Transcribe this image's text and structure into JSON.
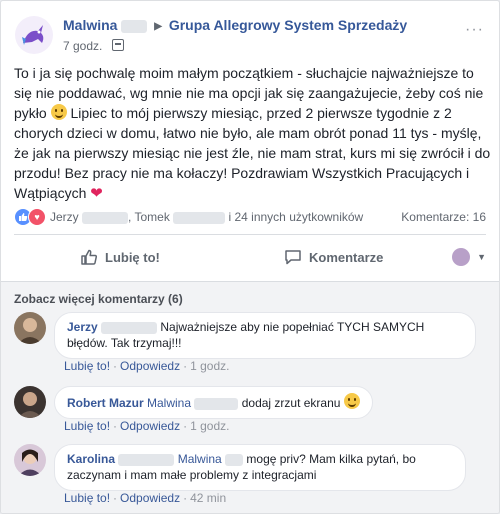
{
  "post": {
    "author": "Malwina",
    "group": "Grupa Allegrowy System Sprzedaży",
    "time": "7 godz.",
    "text_1": "To i ja się pochwalę moim małym początkiem - słuchajcie najważniejsze to się nie poddawać, wg mnie nie ma opcji jak się zaangażujecie, żeby coś nie pykło ",
    "text_2": " Lipiec to mój pierwszy miesiąc, przed 2 pierwsze tygodnie z 2 chorych dzieci w domu, łatwo nie było, ale mam obrót ponad 11 tys - myślę, że jak na pierwszy miesiąc nie jest źle, nie mam strat, kurs mi się zwrócił i do przodu! Bez pracy nie ma kołaczy! Pozdrawiam Wszystkich Pracujących i Wątpiących ",
    "heart": "❤"
  },
  "reactions": {
    "name1": "Jerzy",
    "sep": ", ",
    "name2": "Tomek",
    "others": " i 24 innych użytkowników",
    "comments_count": "Komentarze: 16"
  },
  "actions": {
    "like": "Lubię to!",
    "comment": "Komentarze"
  },
  "comments_section": {
    "see_more": "Zobacz więcej komentarzy (6)",
    "like_label": "Lubię to!",
    "reply_label": "Odpowiedz",
    "items": [
      {
        "author": "Jerzy",
        "tag": "",
        "text": "Najważniejsze aby nie popełniać TYCH SAMYCH błędów. Tak trzymaj!!!",
        "time": "1 godz."
      },
      {
        "author": "Robert Mazur",
        "tag": "Malwina",
        "text": "dodaj zrzut ekranu ",
        "time": "1 godz."
      },
      {
        "author": "Karolina",
        "tag": "Malwina",
        "text": "mogę priv? Mam kilka pytań, bo zaczynam i mam małe problemy z integracjami",
        "time": "42 min"
      }
    ]
  },
  "colors": {
    "link": "#385898",
    "like_reaction": "#5890ff",
    "love_reaction": "#f25268",
    "muted": "#616770"
  }
}
